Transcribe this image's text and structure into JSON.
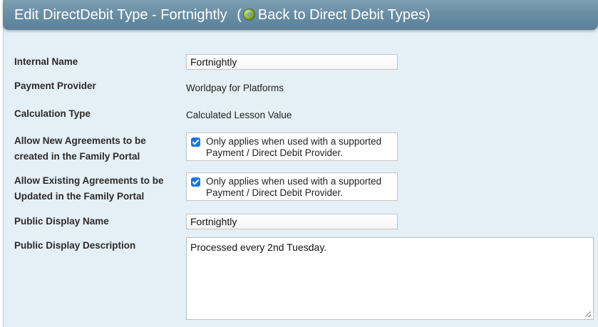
{
  "header": {
    "title": "Edit DirectDebit Type - Fortnightly",
    "open_paren": "(",
    "back_link": "Back to Direct Debit Types",
    "close_paren": ")"
  },
  "form": {
    "internal_name_label": "Internal Name",
    "internal_name_value": "Fortnightly",
    "payment_provider_label": "Payment Provider",
    "payment_provider_value": "Worldpay for Platforms",
    "calculation_type_label": "Calculation Type",
    "calculation_type_value": "Calculated Lesson Value",
    "allow_new_label_1": "Allow New Agreements to be",
    "allow_new_label_2": "created in the Family Portal",
    "allow_new_checked": true,
    "allow_new_note_1": "Only applies when used with a supported",
    "allow_new_note_2": "Payment / Direct Debit Provider.",
    "allow_existing_label_1": "Allow Existing Agreements to be",
    "allow_existing_label_2": "Updated in the Family Portal",
    "allow_existing_checked": true,
    "allow_existing_note_1": "Only applies when used with a supported",
    "allow_existing_note_2": "Payment / Direct Debit Provider.",
    "public_display_name_label": "Public Display Name",
    "public_display_name_value": "Fortnightly",
    "public_display_description_label": "Public Display Description",
    "public_display_description_value": "Processed every 2nd Tuesday."
  },
  "icons": {
    "back_icon": "globe-icon",
    "checkbox": "check-icon",
    "resize": "resize-grip-icon"
  },
  "colors": {
    "header_bg": "#6a8fa5",
    "panel_bg": "#e4f0f6",
    "checkbox_accent": "#1a73e8"
  }
}
